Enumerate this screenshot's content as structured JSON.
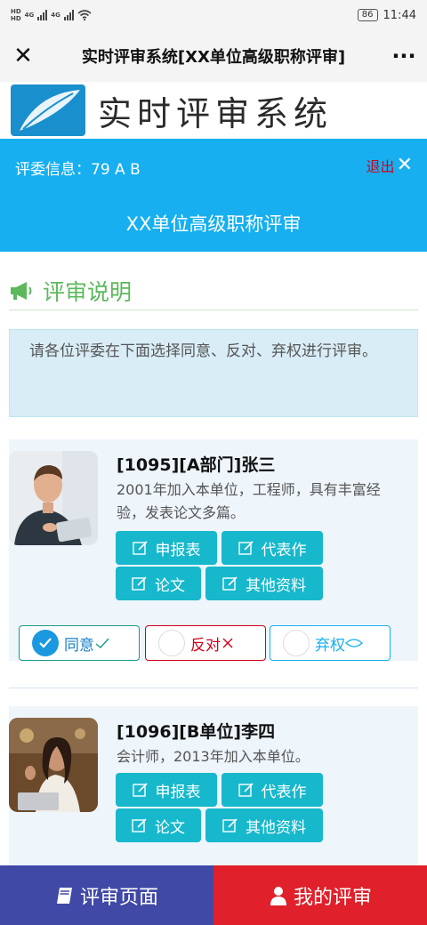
{
  "status_bar": {
    "hd1": "HD",
    "hd2": "HD",
    "net1": "4G",
    "net2": "4G",
    "battery": "86",
    "time": "11:44"
  },
  "title_bar": {
    "close_icon": "close-icon",
    "title": "实时评审系统[XX单位高级职称评审]",
    "more_icon": "more-dots-icon"
  },
  "banner": {
    "text": "实时评审系统"
  },
  "header": {
    "judge_info": "评委信息：79 A B",
    "logout_label": "退出",
    "review_title": "XX单位高级职称评审"
  },
  "instructions": {
    "heading": "评审说明",
    "text": "请各位评委在下面选择同意、反对、弃权进行评审。"
  },
  "candidates": [
    {
      "name": "[1095][A部门]张三",
      "description": "2001年加入本单位，工程师，具有丰富经验，发表论文多篇。",
      "docs": [
        "申报表",
        "代表作",
        "论文",
        "其他资料"
      ],
      "votes": {
        "agree": "同意",
        "oppose": "反对",
        "abstain": "弃权",
        "selected": "agree"
      }
    },
    {
      "name": "[1096][B单位]李四",
      "description": "会计师，2013年加入本单位。",
      "docs": [
        "申报表",
        "代表作",
        "论文",
        "其他资料"
      ]
    }
  ],
  "bottom_nav": {
    "review_page": "评审页面",
    "my_reviews": "我的评审"
  },
  "colors": {
    "header_blue": "#17aff0",
    "doc_button": "#17b8cc",
    "heading_green": "#5cb85c",
    "nav_left": "#4049a6",
    "nav_right": "#e0202a"
  }
}
